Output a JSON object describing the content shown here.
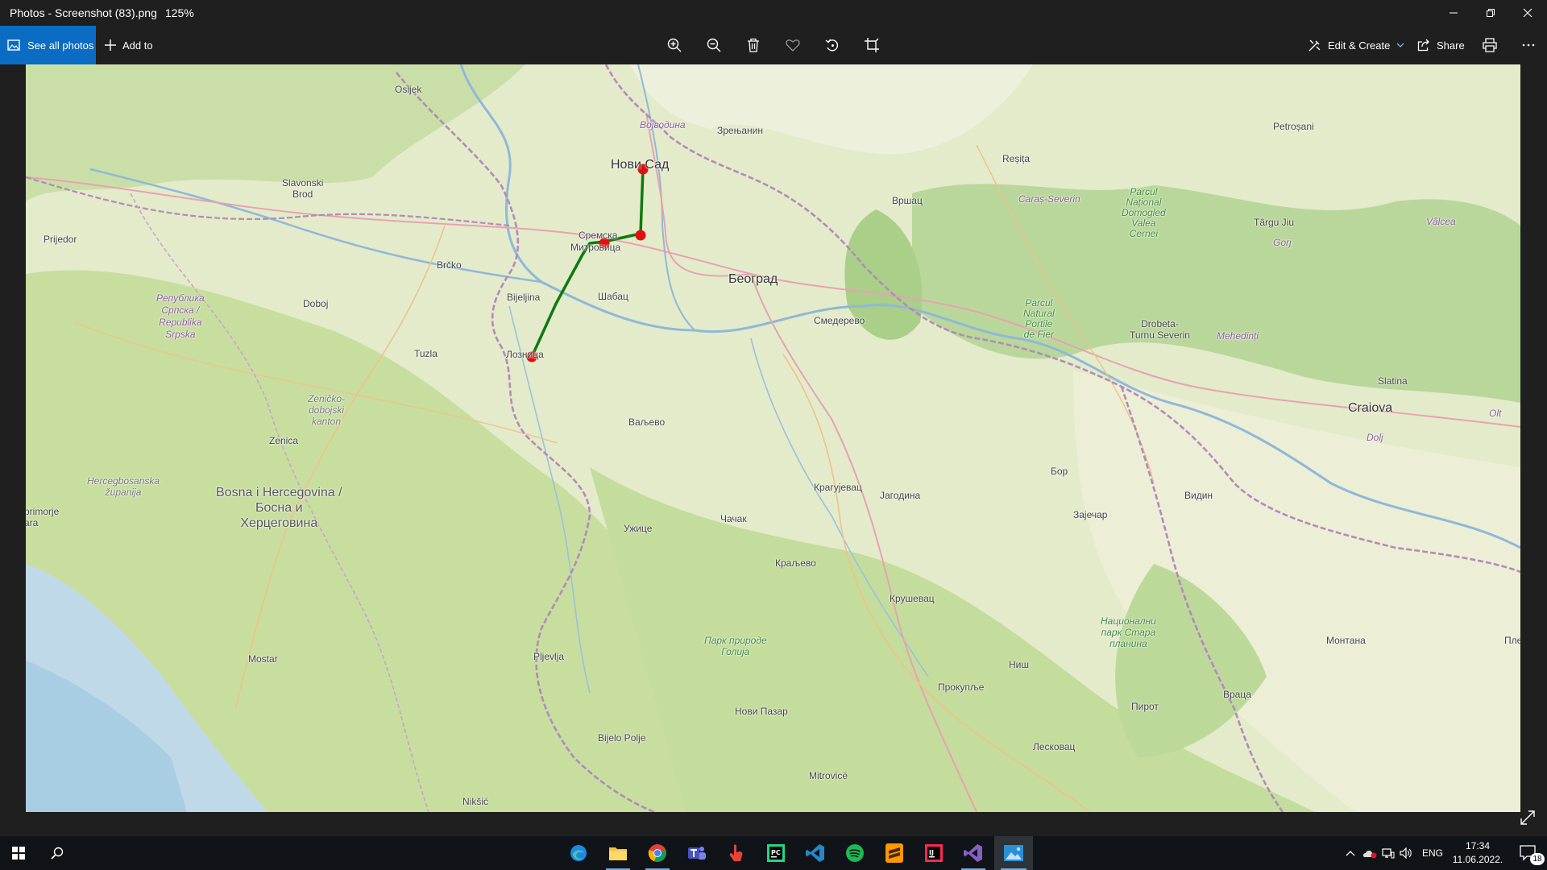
{
  "window": {
    "title": "Photos - Screenshot (83).png",
    "zoom": "125%"
  },
  "toolbar": {
    "see_all_label": "See all photos",
    "add_to_label": "Add to",
    "edit_create_label": "Edit & Create",
    "share_label": "Share"
  },
  "colors": {
    "accent": "#0a6cc2",
    "route": "#0f7a0f",
    "route_points": "#e01010",
    "chrome": "#1f1f1f",
    "taskbar": "#101418"
  },
  "map": {
    "route_points": [
      "Нови Сад",
      "Сремска Митровица",
      "Лозница"
    ],
    "labels": {
      "osijek": "Osijek",
      "vojvodina": "Војводина",
      "zrenjanin": "Зрењанин",
      "novi_sad": "Нови Сад",
      "slavonski_brod": "Slavonski\nBrod",
      "resita": "Reșița",
      "caras_severin": "Caraș-Severin",
      "parcul_national": "Parcul\nNațional\nDomogled\nValea\nCernei",
      "vrsac": "Вршац",
      "petrosani": "Petroșani",
      "targu_jiu": "Târgu Jiu",
      "gorj": "Gorj",
      "valcea": "Vâlcea",
      "prijedor": "Prijedor",
      "sremska": "Сремска",
      "mitrovica": "Митровица",
      "brcko": "Brčko",
      "beograd": "Београд",
      "bijeljina": "Bijeljina",
      "sabac": "Шабац",
      "republika_srpska": "Република\nСрпска /\nRepublika\nSrpska",
      "doboj": "Doboj",
      "smederevo": "Смедерево",
      "parcul_natural": "Parcul\nNatural\nPortile\nde Fier",
      "drobeta": "Drobeta-\nTurnu Severin",
      "mehedinti": "Mehedinți",
      "tuzla": "Tuzla",
      "loznica": "Лозница",
      "slatina": "Slatina",
      "craiova": "Craiova",
      "olt": "Olt",
      "zenicko": "Zeničko-\ndobojski\nkanton",
      "valjevo": "Ваљево",
      "dolj": "Dolj",
      "zenica": "Zenica",
      "bor": "Бор",
      "hercegbosanska": "Hercegbosanska\nžupanija",
      "bih": "Bosna i Hercegovina /\nБосна и\nХерцеговина",
      "kragujevac": "Крагујевац",
      "jagodina": "Јагодина",
      "vidin": "Видин",
      "zajecar": "Зајечар",
      "uzice": "Ужице",
      "cacak": "Чачак",
      "kraljevo": "Краљево",
      "primorje": "primorje\nara",
      "krusevac": "Крушевац",
      "nacionalni_park": "Национални\nпарк Стара\nпланина",
      "park_prirode": "Парк природе\nГолија",
      "montana": "Монтана",
      "pljevlja": "Pljevlja",
      "mostar": "Mostar",
      "nis": "Ниш",
      "pleven": "Пле",
      "prokuplje": "Прокупље",
      "vratsa": "Враца",
      "novi_pazar": "Нови Пазар",
      "pirot": "Пирот",
      "bijelo_polje": "Bijelo Polje",
      "leskovac": "Лесковац",
      "mitrovice": "Mitrovicë",
      "niksic": "Nikšić"
    }
  },
  "taskbar": {
    "language": "ENG",
    "time": "17:34",
    "date": "11.06.2022.",
    "notification_count": "18"
  }
}
